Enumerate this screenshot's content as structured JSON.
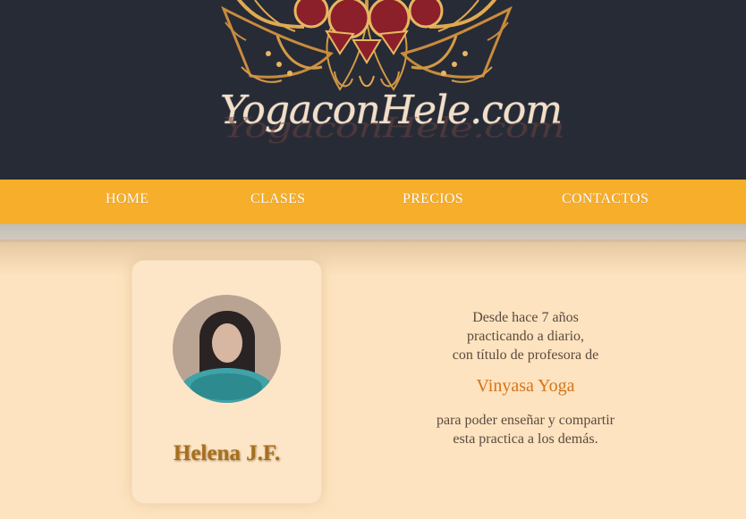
{
  "brand": {
    "name": "YogaconHele.com"
  },
  "nav": {
    "items": [
      {
        "label": "HOME"
      },
      {
        "label": "CLASES"
      },
      {
        "label": "PRECIOS"
      },
      {
        "label": "CONTACTOS"
      }
    ]
  },
  "profile": {
    "name": "Helena J.F.",
    "photo": "profile-photo"
  },
  "bio": {
    "lines_before": [
      "Desde hace 7 años",
      "practicando a diario,",
      "con título de profesora de"
    ],
    "highlight": "Vinyasa Yoga",
    "lines_after": [
      "para poder enseñar y compartir",
      "esta practica a los demás."
    ]
  },
  "colors": {
    "header_bg": "#272b36",
    "nav_bg": "#f7ae2b",
    "page_bg": "#fde3bf",
    "name_color": "#a66f1d",
    "highlight_color": "#d4741c"
  }
}
